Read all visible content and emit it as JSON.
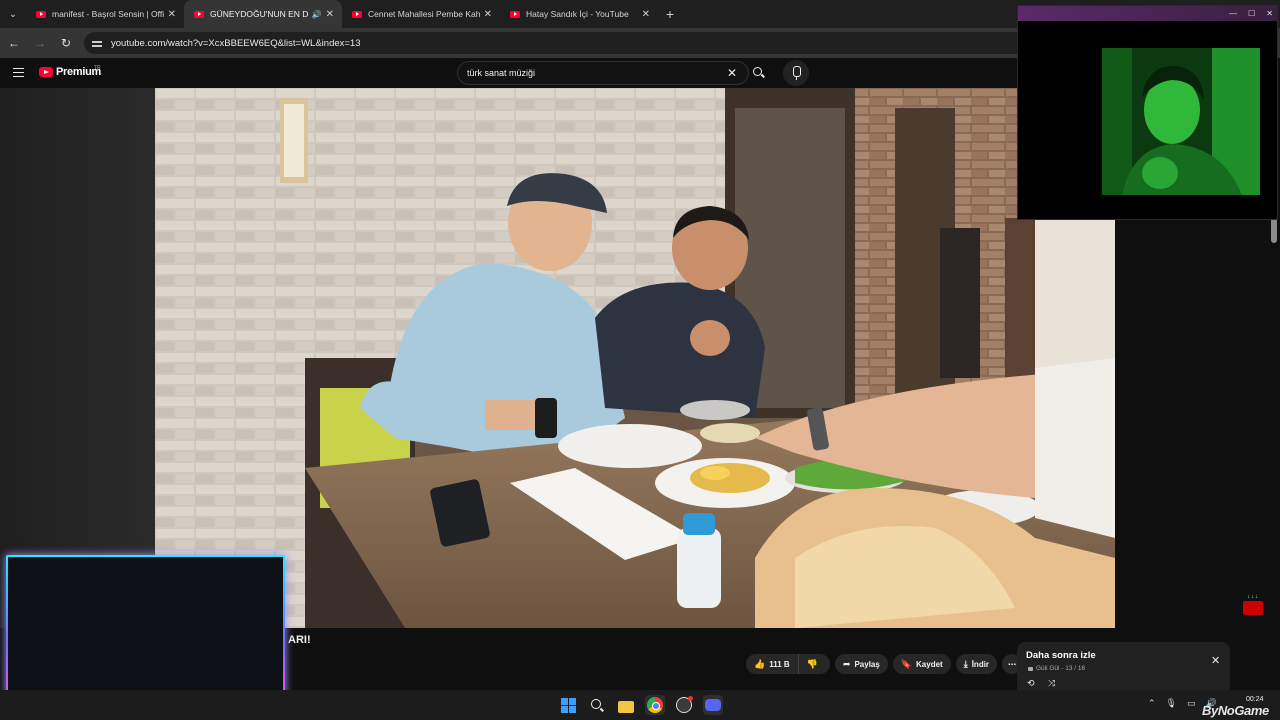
{
  "browser": {
    "tabs": [
      {
        "title": "manifest - Başrol Sensin | Official",
        "active": false,
        "audio": false
      },
      {
        "title": "GÜNEYDOĞU'NUN EN DÜŞ",
        "active": true,
        "audio": true
      },
      {
        "title": "Cennet Mahallesi Pembe Kahkaha",
        "active": false,
        "audio": false
      },
      {
        "title": "Hatay Sandık İçi - YouTube",
        "active": false,
        "audio": false
      }
    ],
    "url": "youtube.com/watch?v=XcxBBEEW6EQ&list=WL&index=13"
  },
  "youtube": {
    "brand": "Premium",
    "region": "TR",
    "search_query": "türk sanat müziği",
    "video_title_partial": "ARI!",
    "actions": {
      "likes": "111 B",
      "share": "Paylaş",
      "save": "Kaydet",
      "download": "İndir"
    },
    "playlist": {
      "title": "Daha sonra izle",
      "owner": "Güli Gül",
      "position": "13 / 16"
    }
  },
  "taskbar": {
    "time": "00:24",
    "apps": [
      "windows-start",
      "search",
      "file-explorer",
      "chrome",
      "obs",
      "discord"
    ]
  },
  "overlay": {
    "watermark": "ByNoGame",
    "colors": {
      "neon_top": "#2ee6ff",
      "neon_bottom": "#ff4fd8",
      "accent": "#ff0033"
    }
  }
}
